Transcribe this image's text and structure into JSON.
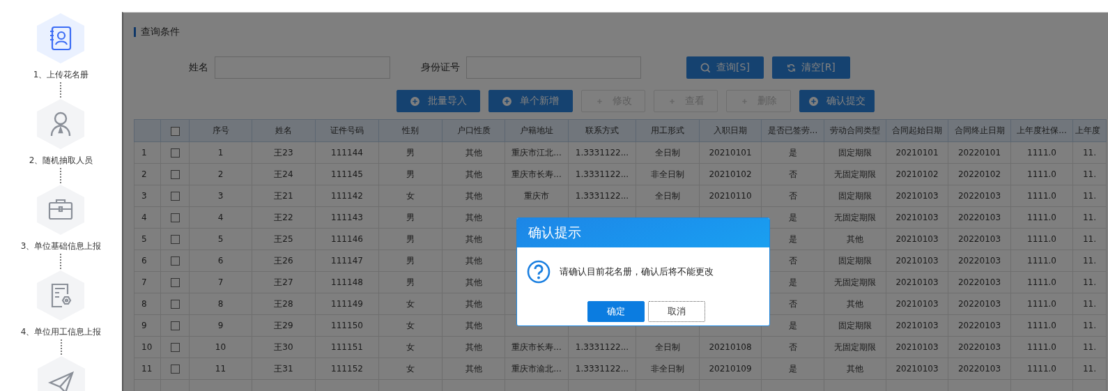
{
  "steps": [
    {
      "label": "1、上传花名册",
      "selected": true
    },
    {
      "label": "2、随机抽取人员",
      "selected": false
    },
    {
      "label": "3、单位基础信息上报",
      "selected": false
    },
    {
      "label": "4、单位用工信息上报",
      "selected": false
    },
    {
      "selected": false
    }
  ],
  "query": {
    "title": "查询条件",
    "fields": [
      {
        "label": "姓名"
      },
      {
        "label": "身份证号"
      }
    ],
    "buttons": [
      {
        "label": "查询[S]"
      },
      {
        "label": "清空[R]"
      }
    ]
  },
  "toolbar": [
    {
      "label": "批量导入",
      "disabled": false
    },
    {
      "label": "单个新增",
      "disabled": false
    },
    {
      "label": "修改",
      "disabled": true
    },
    {
      "label": "查看",
      "disabled": true
    },
    {
      "label": "删除",
      "disabled": true
    },
    {
      "label": "确认提交",
      "disabled": false
    }
  ],
  "table": {
    "all_checked": false,
    "columns": [
      "序号",
      "姓名",
      "证件号码",
      "性别",
      "户口性质",
      "户籍地址",
      "联系方式",
      "用工形式",
      "入职日期",
      "是否已签劳...",
      "劳动合同类型",
      "合同起始日期",
      "合同终止日期",
      "上年度社保...",
      "上年度"
    ],
    "rows": [
      {
        "row_number": "1",
        "checked": false,
        "cells": [
          "1",
          "王23",
          "111144",
          "男",
          "其他",
          "重庆市江北...",
          "1.3331122...",
          "全日制",
          "20210101",
          "是",
          "固定期限",
          "20210101",
          "20220101",
          "1111.0",
          "11."
        ]
      },
      {
        "row_number": "2",
        "checked": false,
        "cells": [
          "2",
          "王24",
          "111145",
          "男",
          "其他",
          "重庆市长寿...",
          "1.3331122...",
          "非全日制",
          "20210102",
          "否",
          "无固定期限",
          "20210102",
          "20220102",
          "1111.0",
          "11."
        ]
      },
      {
        "row_number": "3",
        "checked": false,
        "cells": [
          "3",
          "王21",
          "111142",
          "女",
          "其他",
          "重庆市",
          "1.3331122...",
          "全日制",
          "20210110",
          "否",
          "固定期限",
          "20210103",
          "20220103",
          "1111.0",
          "11."
        ]
      },
      {
        "row_number": "4",
        "checked": false,
        "cells": [
          "4",
          "王22",
          "111143",
          "男",
          "其他",
          null,
          null,
          null,
          null,
          "是",
          "无固定期限",
          "20210103",
          "20220103",
          "1111.0",
          "11."
        ]
      },
      {
        "row_number": "5",
        "checked": false,
        "cells": [
          "5",
          "王25",
          "111146",
          "男",
          "其他",
          null,
          null,
          null,
          null,
          "是",
          "其他",
          "20210103",
          "20220103",
          "1111.0",
          "11."
        ]
      },
      {
        "row_number": "6",
        "checked": false,
        "cells": [
          "6",
          "王26",
          "111147",
          "男",
          "其他",
          null,
          null,
          null,
          null,
          "否",
          "固定期限",
          "20210103",
          "20220103",
          "1111.0",
          "11."
        ]
      },
      {
        "row_number": "7",
        "checked": false,
        "cells": [
          "7",
          "王27",
          "111148",
          "男",
          "其他",
          null,
          null,
          null,
          null,
          "是",
          "无固定期限",
          "20210103",
          "20220103",
          "1111.0",
          "11."
        ]
      },
      {
        "row_number": "8",
        "checked": false,
        "cells": [
          "8",
          "王28",
          "111149",
          "女",
          "其他",
          null,
          null,
          null,
          null,
          "否",
          "其他",
          "20210103",
          "20220103",
          "1111.0",
          "11."
        ]
      },
      {
        "row_number": "9",
        "checked": false,
        "cells": [
          "9",
          "王29",
          "111150",
          "女",
          "其他",
          null,
          null,
          null,
          null,
          "是",
          "固定期限",
          "20210103",
          "20220103",
          "1111.0",
          "11."
        ]
      },
      {
        "row_number": "10",
        "checked": false,
        "cells": [
          "10",
          "王30",
          "111151",
          "女",
          "其他",
          "重庆市长寿...",
          "1.3331122...",
          "全日制",
          "20210108",
          "否",
          "无固定期限",
          "20210103",
          "20220103",
          "1111.0",
          "11."
        ]
      },
      {
        "row_number": "11",
        "checked": false,
        "cells": [
          "11",
          "王31",
          "111152",
          "女",
          "其他",
          "重庆市渝北...",
          "1.3331122...",
          "非全日制",
          "20210109",
          "是",
          "其他",
          "20210103",
          "20220103",
          "1111.0",
          "11."
        ]
      }
    ]
  },
  "dialog": {
    "title": "确认提示",
    "message": "请确认目前花名册，确认后将不能更改",
    "buttons": [
      {
        "label": "确定",
        "kind": "primary"
      },
      {
        "label": "取消",
        "kind": "default"
      }
    ]
  }
}
